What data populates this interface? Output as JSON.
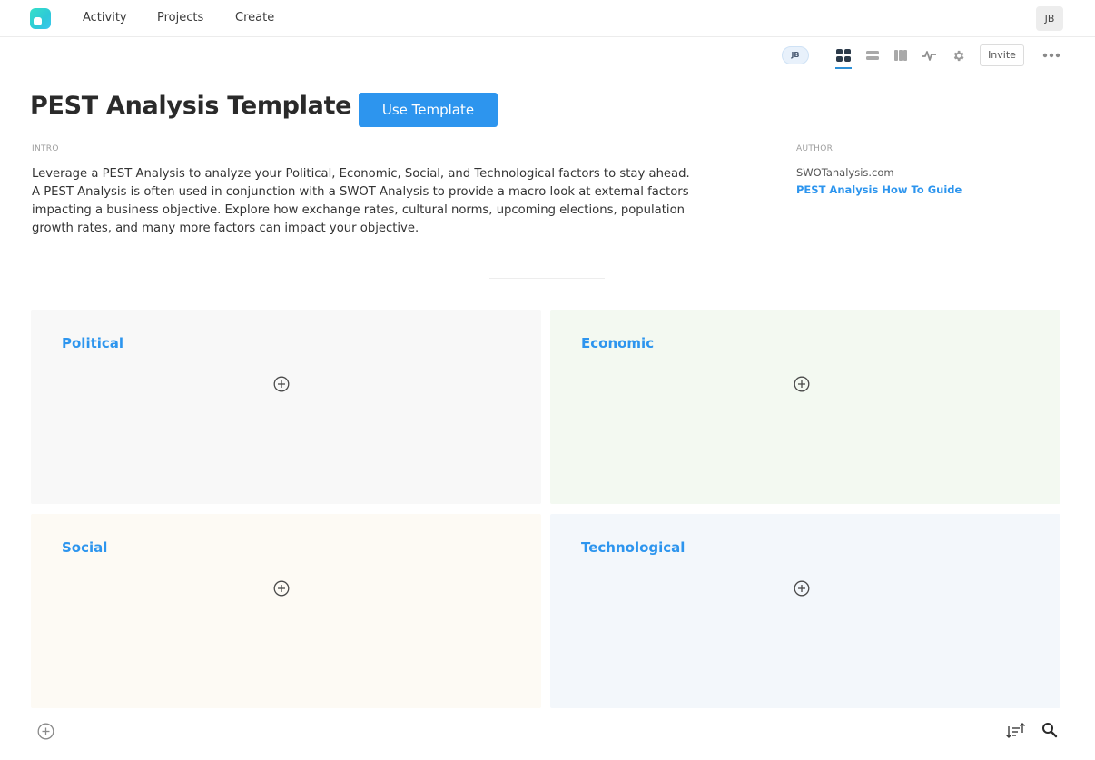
{
  "nav": {
    "links": [
      "Activity",
      "Projects",
      "Create"
    ],
    "user_initials": "JB"
  },
  "toolbar": {
    "member_initials": "JB",
    "tools": [
      "grid-view-icon",
      "list-view-icon",
      "columns-view-icon",
      "activity-icon",
      "settings-icon"
    ],
    "invite_label": "Invite",
    "more_icon": "more-dots-icon"
  },
  "header": {
    "title": "PEST Analysis Template",
    "use_template_label": "Use Template"
  },
  "intro": {
    "label": "INTRO",
    "text": "Leverage a PEST Analysis to analyze your Political, Economic, Social, and Technological factors to stay ahead. A PEST Analysis is often used in conjunction with a SWOT Analysis to provide a macro look at external factors impacting a business objective. Explore how exchange rates, cultural norms, upcoming elections, population growth rates, and many more factors can impact your objective."
  },
  "author": {
    "label": "AUTHOR",
    "name": "SWOTanalysis.com",
    "link_text": "PEST Analysis How To Guide"
  },
  "quadrants": [
    {
      "title": "Political",
      "color": "#f8f8f8"
    },
    {
      "title": "Economic",
      "color": "#f3f9f1"
    },
    {
      "title": "Social",
      "color": "#fdfaf4"
    },
    {
      "title": "Technological",
      "color": "#f3f7fb"
    }
  ],
  "colors": {
    "accent": "#2d95ee",
    "title_text": "#2a2a2a"
  },
  "bottom_bar": {
    "icons": [
      "add-circle-icon",
      "sort-icon",
      "search-icon"
    ]
  }
}
